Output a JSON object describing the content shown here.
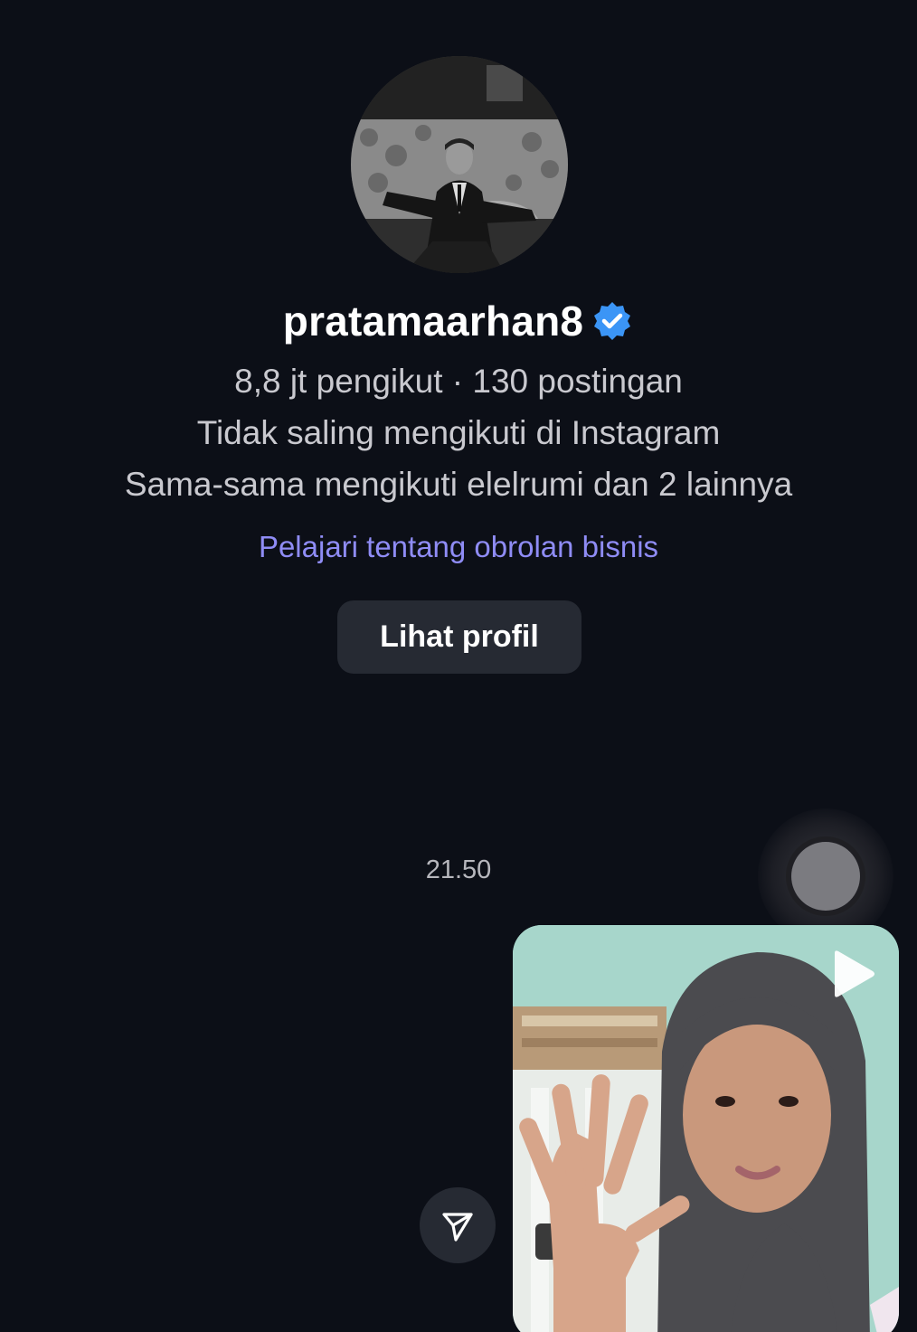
{
  "profile": {
    "username": "pratamaarhan8",
    "stats_line": "8,8 jt pengikut · 130 postingan",
    "follow_status": "Tidak saling mengikuti di Instagram",
    "mutual": "Sama-sama mengikuti elelrumi dan 2 lainnya",
    "business_link": "Pelajari tentang obrolan bisnis",
    "view_profile_label": "Lihat profil"
  },
  "chat": {
    "timestamp": "21.50"
  },
  "icons": {
    "verified": "verified-badge-icon",
    "share": "send-icon",
    "play": "play-icon",
    "record": "record-icon"
  },
  "colors": {
    "background": "#0c0f17",
    "link": "#8f8cf5",
    "verified": "#3b95f6",
    "button_bg": "#262a33"
  }
}
